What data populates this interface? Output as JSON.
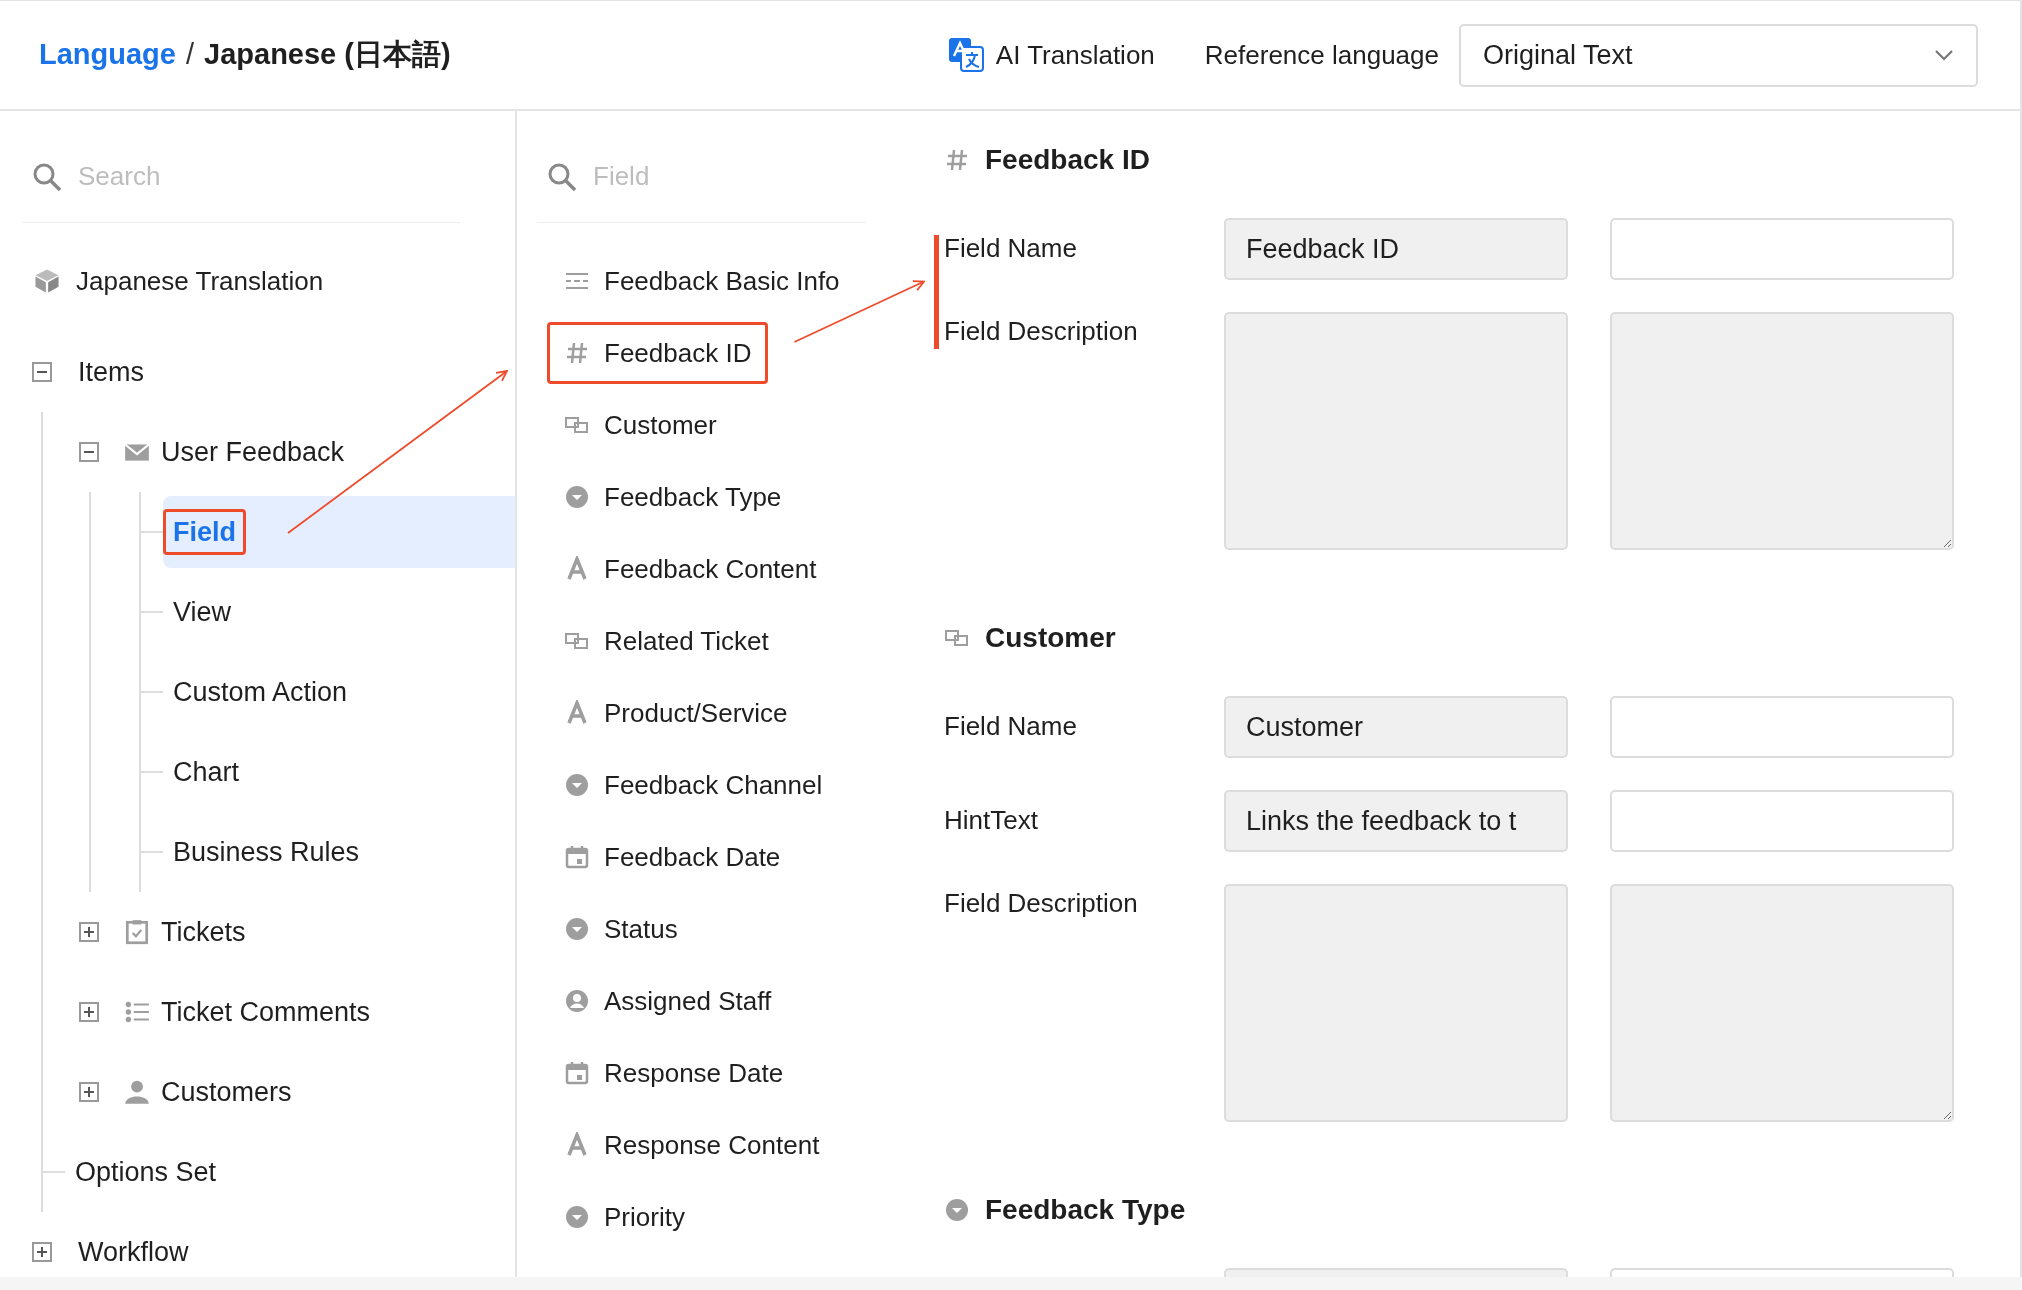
{
  "header": {
    "breadcrumb": [
      {
        "label": "Language",
        "link": true
      },
      {
        "label": "Japanese (日本語)",
        "link": false
      }
    ],
    "separator": "/",
    "ai_button": "AI Translation",
    "reference_label": "Reference language",
    "reference_select": "Original Text"
  },
  "sidebar": {
    "search": {
      "placeholder": "Search"
    },
    "project": "Japanese Translation",
    "tree": [
      {
        "label": "Items",
        "expanded": true,
        "selected": false,
        "highlighted": false,
        "children": [
          {
            "label": "User Feedback",
            "kind": "mail",
            "expanded": true,
            "selected": false,
            "highlighted": false,
            "children": [
              {
                "label": "Field",
                "selected": true,
                "highlighted": true
              },
              {
                "label": "View",
                "selected": false,
                "highlighted": false
              },
              {
                "label": "Custom Action",
                "selected": false,
                "highlighted": false
              },
              {
                "label": "Chart",
                "selected": false,
                "highlighted": false
              },
              {
                "label": "Business Rules",
                "selected": false,
                "highlighted": false
              }
            ]
          },
          {
            "label": "Tickets",
            "kind": "ticket",
            "expanded": false,
            "selected": false,
            "highlighted": false
          },
          {
            "label": "Ticket Comments",
            "kind": "list",
            "expanded": false,
            "selected": false,
            "highlighted": false
          },
          {
            "label": "Customers",
            "kind": "person",
            "expanded": false,
            "selected": false,
            "highlighted": false
          },
          {
            "label": "Options Set",
            "selected": false,
            "highlighted": false
          }
        ]
      },
      {
        "label": "Workflow",
        "expanded": false,
        "selected": false,
        "highlighted": false
      }
    ]
  },
  "field_list": {
    "search": {
      "placeholder": "Field"
    },
    "items": [
      {
        "label": "Feedback Basic Info",
        "kind": "section",
        "highlighted": false
      },
      {
        "label": "Feedback ID",
        "kind": "number",
        "highlighted": true
      },
      {
        "label": "Customer",
        "kind": "reference",
        "highlighted": false
      },
      {
        "label": "Feedback Type",
        "kind": "select",
        "highlighted": false
      },
      {
        "label": "Feedback Content",
        "kind": "text",
        "highlighted": false
      },
      {
        "label": "Related Ticket",
        "kind": "reference",
        "highlighted": false
      },
      {
        "label": "Product/Service",
        "kind": "text",
        "highlighted": false
      },
      {
        "label": "Feedback Channel",
        "kind": "select",
        "highlighted": false
      },
      {
        "label": "Feedback Date",
        "kind": "date",
        "highlighted": false
      },
      {
        "label": "Status",
        "kind": "select",
        "highlighted": false
      },
      {
        "label": "Assigned Staff",
        "kind": "user",
        "highlighted": false
      },
      {
        "label": "Response Date",
        "kind": "date",
        "highlighted": false
      },
      {
        "label": "Response Content",
        "kind": "text",
        "highlighted": false
      },
      {
        "label": "Priority",
        "kind": "select",
        "highlighted": false
      }
    ]
  },
  "sections": [
    {
      "title": "Feedback ID",
      "kind": "number",
      "annotated": true,
      "fields": [
        {
          "label": "Field Name",
          "kind": "input",
          "reference": "Feedback ID",
          "disabled": false
        },
        {
          "label": "Field Description",
          "kind": "textarea",
          "disabled": true
        }
      ]
    },
    {
      "title": "Customer",
      "kind": "reference",
      "annotated": false,
      "fields": [
        {
          "label": "Field Name",
          "kind": "input",
          "reference": "Customer",
          "disabled": false
        },
        {
          "label": "HintText",
          "kind": "input",
          "reference": "Links the feedback to t",
          "disabled": false
        },
        {
          "label": "Field Description",
          "kind": "textarea",
          "disabled": true
        }
      ]
    },
    {
      "title": "Feedback Type",
      "kind": "select",
      "annotated": false,
      "fields": [
        {
          "kind": "input",
          "disabled": false
        }
      ]
    }
  ]
}
